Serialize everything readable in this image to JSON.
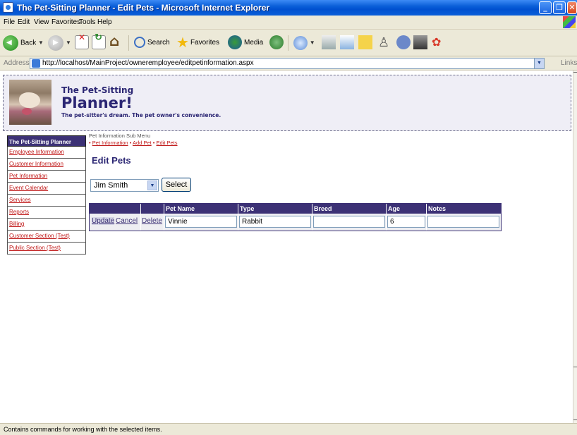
{
  "window": {
    "title": "The Pet-Sitting Planner - Edit Pets - Microsoft Internet Explorer"
  },
  "menu": [
    "File",
    "Edit",
    "View",
    "Favorites",
    "Tools",
    "Help"
  ],
  "toolbar": {
    "back": "Back",
    "search": "Search",
    "favorites": "Favorites",
    "media": "Media"
  },
  "address": {
    "label": "Address",
    "url": "http://localhost/MainProject/owneremployee/editpetinformation.aspx",
    "links": "Links"
  },
  "header": {
    "line1": "The Pet-Sitting",
    "line2": "Planner!",
    "tagline": "The pet-sitter's dream. The pet owner's convenience."
  },
  "nav": {
    "title": "The Pet-Sitting Planner",
    "items": [
      "Employee Information",
      "Customer Information",
      "Pet Information",
      "Event Calendar",
      "Services",
      "Reports",
      "Billing",
      "Customer Section (Test)",
      "Public Section (Test)"
    ]
  },
  "submenu": {
    "title": "Pet Information Sub Menu",
    "links": [
      "Pet Information",
      "Add Pet",
      "Edit Pets"
    ],
    "bullet": "•"
  },
  "page": {
    "title": "Edit Pets"
  },
  "owner_select": {
    "value": "Jim Smith",
    "button": "Select"
  },
  "grid": {
    "headers": [
      "Pet Name",
      "Type",
      "Breed",
      "Age",
      "Notes"
    ],
    "row": {
      "update": "Update",
      "cancel": "Cancel",
      "delete": "Delete",
      "pet_name": "Vinnie",
      "type": "Rabbit",
      "breed": "",
      "age": "6",
      "notes": ""
    }
  },
  "status": {
    "text": "Contains commands for working with the selected items."
  }
}
